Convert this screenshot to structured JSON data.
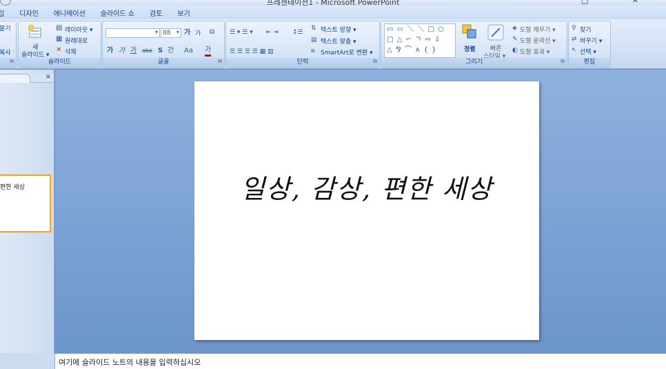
{
  "window": {
    "title": "프레젠테이션1 - Microsoft PowerPoint",
    "controls": "□ ✕"
  },
  "tabs": [
    "입",
    "디자인",
    "애니메이션",
    "슬라이드 쇼",
    "검토",
    "보기"
  ],
  "ribbon": {
    "clipboard": {
      "partial_top": "붙기",
      "partial_bottom": "복사",
      "launcher": "⧉"
    },
    "slides": {
      "new_slide_top": "새",
      "new_slide_bottom": "슬라이드 ▾",
      "layout": "레이아웃 ▾",
      "reset": "원래대로",
      "delete": "삭제",
      "label": "슬라이드"
    },
    "font": {
      "font_name": "",
      "font_size": "88",
      "grow": "가",
      "shrink": "가",
      "clear": "가",
      "bold": "가",
      "italic": "가",
      "underline": "가",
      "strike": "abe",
      "shadow": "S",
      "spacing": "간",
      "case": "Aa",
      "color": "가",
      "label": "글꼴",
      "launcher": "⧉"
    },
    "paragraph": {
      "text_direction": "텍스트 방향 ▾",
      "align_text": "텍스트 맞춤 ▾",
      "smartart": "SmartArt로 변환 ▾",
      "label": "단락",
      "launcher": "⧉"
    },
    "drawing": {
      "shapes_row1": "▭ ▭ ＼ ＼ □ ○",
      "shapes_row2": "□ △ ⌐ ㄱ ⇨ ⇩",
      "shapes_row3": "△ ⅋ ⌒ ∧ { }",
      "arrange": "정렬",
      "quick_styles_top": "빠른",
      "quick_styles_bottom": "스타일 ▾",
      "fill": "도형 채우기 ▾",
      "outline": "도형 윤곽선 ▾",
      "effects": "도형 효과 ▾",
      "label": "그리기",
      "launcher": "⧉"
    },
    "editing": {
      "find": "찾기",
      "replace": "바꾸기 ▾",
      "select": "선택 ▾",
      "label": "편집"
    }
  },
  "panel": {
    "close": "×",
    "thumbnail_text": "편한 세상"
  },
  "slide": {
    "title_text": "일상, 감상, 편한 세상"
  },
  "notes": {
    "placeholder": "여기에 슬라이드 노트의 내용을 입력하십시오"
  }
}
